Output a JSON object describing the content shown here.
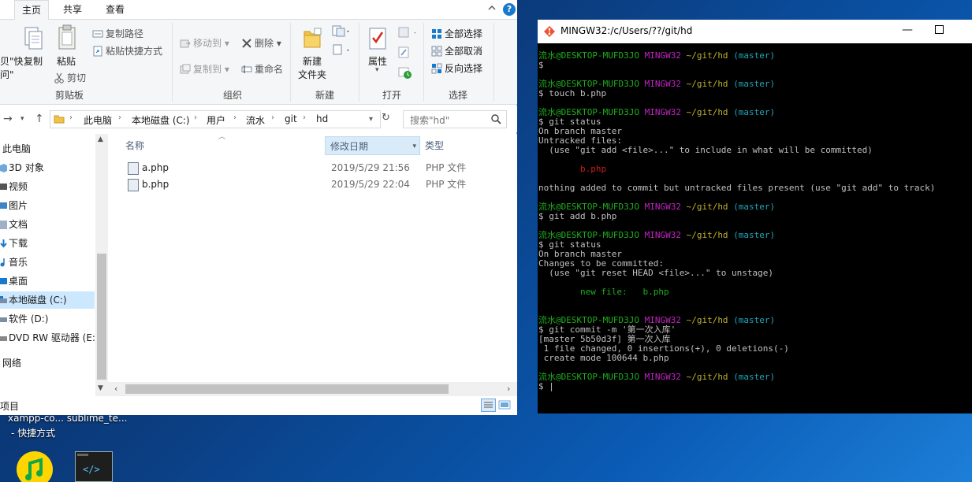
{
  "explorer": {
    "tabs": [
      "主页",
      "共享",
      "查看"
    ],
    "ribbon": {
      "clipboard": {
        "partial_labels": [
          "贝\"快",
          "问\""
        ],
        "copy": "复制",
        "paste": "粘贴",
        "copy_path": "复制路径",
        "paste_shortcut": "粘贴快捷方式",
        "cut": "剪切",
        "group": "剪贴板"
      },
      "organize": {
        "move_to": "移动到",
        "copy_to": "复制到",
        "delete": "删除",
        "rename": "重命名",
        "group": "组织"
      },
      "new": {
        "new_folder_line1": "新建",
        "new_folder_line2": "文件夹",
        "group": "新建"
      },
      "open": {
        "properties": "属性",
        "group": "打开"
      },
      "select": {
        "select_all": "全部选择",
        "select_none": "全部取消",
        "invert": "反向选择",
        "group": "选择"
      }
    },
    "breadcrumb": [
      "此电脑",
      "本地磁盘 (C:)",
      "用户",
      "流水",
      "git",
      "hd"
    ],
    "search_placeholder": "搜索\"hd\"",
    "nav": {
      "items": [
        "此电脑",
        "3D 对象",
        "视频",
        "图片",
        "文档",
        "下载",
        "音乐",
        "桌面",
        "本地磁盘 (C:)",
        "软件 (D:)",
        "DVD RW 驱动器 (E:)",
        "网络"
      ],
      "selected": "本地磁盘 (C:)"
    },
    "columns": {
      "name": "名称",
      "date": "修改日期",
      "type": "类型"
    },
    "files": [
      {
        "name": "a.php",
        "date": "2019/5/29 21:56",
        "type": "PHP 文件"
      },
      {
        "name": "b.php",
        "date": "2019/5/29 22:04",
        "type": "PHP 文件"
      }
    ],
    "status_text": "项目"
  },
  "desktop": {
    "label_row1": "xampp-co...   sublime_te...",
    "label_row2": "- 快捷方式"
  },
  "terminal": {
    "title": "MINGW32:/c/Users/??/git/hd",
    "prompt": {
      "user": "流水@DESKTOP-MUFD3JO",
      "env": "MINGW32",
      "path": "~/git/hd",
      "branch": "(master)"
    },
    "lines": [
      {
        "k": "prompt"
      },
      {
        "k": "cmd",
        "t": "$"
      },
      {
        "k": "blank"
      },
      {
        "k": "prompt"
      },
      {
        "k": "cmd",
        "t": "$ touch b.php"
      },
      {
        "k": "blank"
      },
      {
        "k": "prompt"
      },
      {
        "k": "cmd",
        "t": "$ git status"
      },
      {
        "k": "out",
        "t": "On branch master"
      },
      {
        "k": "out",
        "t": "Untracked files:"
      },
      {
        "k": "out",
        "t": "  (use \"git add <file>...\" to include in what will be committed)"
      },
      {
        "k": "blank"
      },
      {
        "k": "red",
        "t": "        b.php"
      },
      {
        "k": "blank"
      },
      {
        "k": "out",
        "t": "nothing added to commit but untracked files present (use \"git add\" to track)"
      },
      {
        "k": "blank"
      },
      {
        "k": "prompt"
      },
      {
        "k": "cmd",
        "t": "$ git add b.php"
      },
      {
        "k": "blank"
      },
      {
        "k": "prompt"
      },
      {
        "k": "cmd",
        "t": "$ git status"
      },
      {
        "k": "out",
        "t": "On branch master"
      },
      {
        "k": "out",
        "t": "Changes to be committed:"
      },
      {
        "k": "out",
        "t": "  (use \"git reset HEAD <file>...\" to unstage)"
      },
      {
        "k": "blank"
      },
      {
        "k": "green",
        "t": "        new file:   b.php"
      },
      {
        "k": "blank"
      },
      {
        "k": "blank"
      },
      {
        "k": "prompt"
      },
      {
        "k": "cmd",
        "t": "$ git commit -m '第一次入库'"
      },
      {
        "k": "out",
        "t": "[master 5b50d3f] 第一次入库"
      },
      {
        "k": "out",
        "t": " 1 file changed, 0 insertions(+), 0 deletions(-)"
      },
      {
        "k": "out",
        "t": " create mode 100644 b.php"
      },
      {
        "k": "blank"
      },
      {
        "k": "prompt"
      },
      {
        "k": "cmd",
        "t": "$ |"
      }
    ]
  }
}
